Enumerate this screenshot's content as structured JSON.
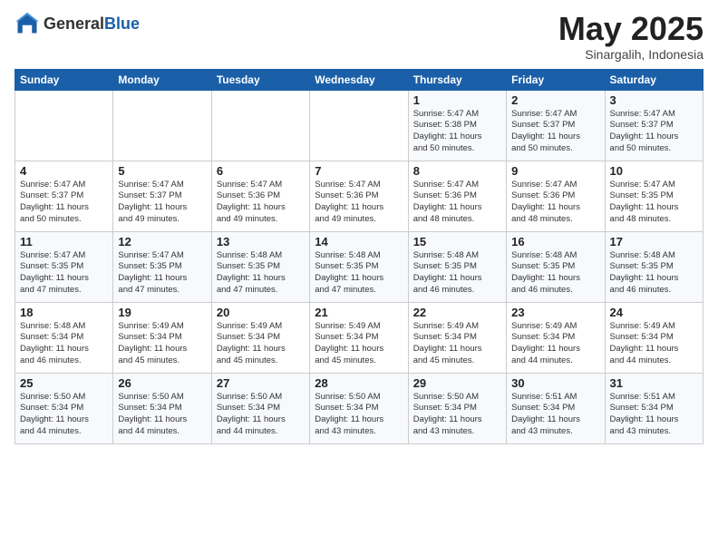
{
  "header": {
    "logo_general": "General",
    "logo_blue": "Blue",
    "title": "May 2025",
    "subtitle": "Sinargalih, Indonesia"
  },
  "days_of_week": [
    "Sunday",
    "Monday",
    "Tuesday",
    "Wednesday",
    "Thursday",
    "Friday",
    "Saturday"
  ],
  "weeks": [
    [
      {
        "num": "",
        "info": ""
      },
      {
        "num": "",
        "info": ""
      },
      {
        "num": "",
        "info": ""
      },
      {
        "num": "",
        "info": ""
      },
      {
        "num": "1",
        "info": "Sunrise: 5:47 AM\nSunset: 5:38 PM\nDaylight: 11 hours\nand 50 minutes."
      },
      {
        "num": "2",
        "info": "Sunrise: 5:47 AM\nSunset: 5:37 PM\nDaylight: 11 hours\nand 50 minutes."
      },
      {
        "num": "3",
        "info": "Sunrise: 5:47 AM\nSunset: 5:37 PM\nDaylight: 11 hours\nand 50 minutes."
      }
    ],
    [
      {
        "num": "4",
        "info": "Sunrise: 5:47 AM\nSunset: 5:37 PM\nDaylight: 11 hours\nand 50 minutes."
      },
      {
        "num": "5",
        "info": "Sunrise: 5:47 AM\nSunset: 5:37 PM\nDaylight: 11 hours\nand 49 minutes."
      },
      {
        "num": "6",
        "info": "Sunrise: 5:47 AM\nSunset: 5:36 PM\nDaylight: 11 hours\nand 49 minutes."
      },
      {
        "num": "7",
        "info": "Sunrise: 5:47 AM\nSunset: 5:36 PM\nDaylight: 11 hours\nand 49 minutes."
      },
      {
        "num": "8",
        "info": "Sunrise: 5:47 AM\nSunset: 5:36 PM\nDaylight: 11 hours\nand 48 minutes."
      },
      {
        "num": "9",
        "info": "Sunrise: 5:47 AM\nSunset: 5:36 PM\nDaylight: 11 hours\nand 48 minutes."
      },
      {
        "num": "10",
        "info": "Sunrise: 5:47 AM\nSunset: 5:35 PM\nDaylight: 11 hours\nand 48 minutes."
      }
    ],
    [
      {
        "num": "11",
        "info": "Sunrise: 5:47 AM\nSunset: 5:35 PM\nDaylight: 11 hours\nand 47 minutes."
      },
      {
        "num": "12",
        "info": "Sunrise: 5:47 AM\nSunset: 5:35 PM\nDaylight: 11 hours\nand 47 minutes."
      },
      {
        "num": "13",
        "info": "Sunrise: 5:48 AM\nSunset: 5:35 PM\nDaylight: 11 hours\nand 47 minutes."
      },
      {
        "num": "14",
        "info": "Sunrise: 5:48 AM\nSunset: 5:35 PM\nDaylight: 11 hours\nand 47 minutes."
      },
      {
        "num": "15",
        "info": "Sunrise: 5:48 AM\nSunset: 5:35 PM\nDaylight: 11 hours\nand 46 minutes."
      },
      {
        "num": "16",
        "info": "Sunrise: 5:48 AM\nSunset: 5:35 PM\nDaylight: 11 hours\nand 46 minutes."
      },
      {
        "num": "17",
        "info": "Sunrise: 5:48 AM\nSunset: 5:35 PM\nDaylight: 11 hours\nand 46 minutes."
      }
    ],
    [
      {
        "num": "18",
        "info": "Sunrise: 5:48 AM\nSunset: 5:34 PM\nDaylight: 11 hours\nand 46 minutes."
      },
      {
        "num": "19",
        "info": "Sunrise: 5:49 AM\nSunset: 5:34 PM\nDaylight: 11 hours\nand 45 minutes."
      },
      {
        "num": "20",
        "info": "Sunrise: 5:49 AM\nSunset: 5:34 PM\nDaylight: 11 hours\nand 45 minutes."
      },
      {
        "num": "21",
        "info": "Sunrise: 5:49 AM\nSunset: 5:34 PM\nDaylight: 11 hours\nand 45 minutes."
      },
      {
        "num": "22",
        "info": "Sunrise: 5:49 AM\nSunset: 5:34 PM\nDaylight: 11 hours\nand 45 minutes."
      },
      {
        "num": "23",
        "info": "Sunrise: 5:49 AM\nSunset: 5:34 PM\nDaylight: 11 hours\nand 44 minutes."
      },
      {
        "num": "24",
        "info": "Sunrise: 5:49 AM\nSunset: 5:34 PM\nDaylight: 11 hours\nand 44 minutes."
      }
    ],
    [
      {
        "num": "25",
        "info": "Sunrise: 5:50 AM\nSunset: 5:34 PM\nDaylight: 11 hours\nand 44 minutes."
      },
      {
        "num": "26",
        "info": "Sunrise: 5:50 AM\nSunset: 5:34 PM\nDaylight: 11 hours\nand 44 minutes."
      },
      {
        "num": "27",
        "info": "Sunrise: 5:50 AM\nSunset: 5:34 PM\nDaylight: 11 hours\nand 44 minutes."
      },
      {
        "num": "28",
        "info": "Sunrise: 5:50 AM\nSunset: 5:34 PM\nDaylight: 11 hours\nand 43 minutes."
      },
      {
        "num": "29",
        "info": "Sunrise: 5:50 AM\nSunset: 5:34 PM\nDaylight: 11 hours\nand 43 minutes."
      },
      {
        "num": "30",
        "info": "Sunrise: 5:51 AM\nSunset: 5:34 PM\nDaylight: 11 hours\nand 43 minutes."
      },
      {
        "num": "31",
        "info": "Sunrise: 5:51 AM\nSunset: 5:34 PM\nDaylight: 11 hours\nand 43 minutes."
      }
    ]
  ]
}
